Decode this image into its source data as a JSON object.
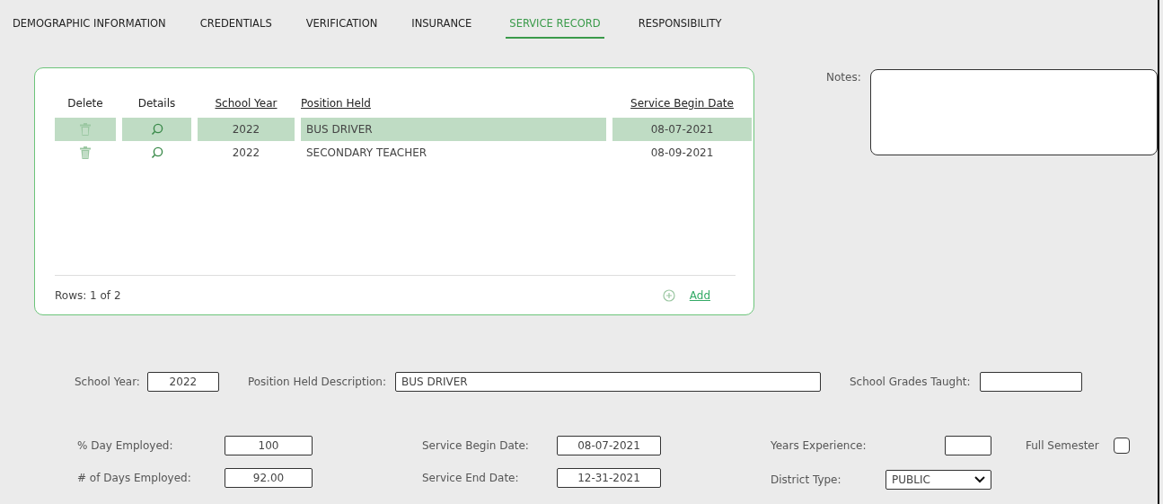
{
  "tabs": [
    {
      "label": "DEMOGRAPHIC INFORMATION",
      "selected": false
    },
    {
      "label": "CREDENTIALS",
      "selected": false
    },
    {
      "label": "VERIFICATION",
      "selected": false
    },
    {
      "label": "INSURANCE",
      "selected": false
    },
    {
      "label": "SERVICE RECORD",
      "selected": true
    },
    {
      "label": "RESPONSIBILITY",
      "selected": false
    }
  ],
  "table": {
    "columns": [
      {
        "label": "Delete",
        "sortable": false
      },
      {
        "label": "Details",
        "sortable": false
      },
      {
        "label": "School Year",
        "sortable": true
      },
      {
        "label": "Position Held",
        "sortable": true
      },
      {
        "label": "Service Begin Date",
        "sortable": true
      }
    ],
    "rows": [
      {
        "school_year": "2022",
        "position_held": "BUS DRIVER",
        "service_begin_date": "08-07-2021",
        "selected": true
      },
      {
        "school_year": "2022",
        "position_held": "SECONDARY TEACHER",
        "service_begin_date": "08-09-2021",
        "selected": false
      }
    ],
    "row_count": "Rows: 1 of 2",
    "add_link": "Add"
  },
  "notes": {
    "label": "Notes:"
  },
  "form": {
    "school_year": {
      "label": "School Year:",
      "value": "2022"
    },
    "position_held_description": {
      "label": "Position Held Description:",
      "value": "BUS DRIVER"
    },
    "school_grades_taught": {
      "label": "School Grades Taught:"
    },
    "percent_day_employed": {
      "label": "% Day Employed:",
      "value": "100"
    },
    "days_employed": {
      "label": "# of Days Employed:",
      "value": "92.00"
    },
    "service_begin_date": {
      "label": "Service Begin Date:",
      "value": "08-07-2021"
    },
    "service_end_date": {
      "label": "Service End Date:",
      "value": "12-31-2021"
    },
    "years_experience": {
      "label": "Years Experience:"
    },
    "district_type": {
      "label": "District Type:",
      "value": "PUBLIC"
    },
    "full_semester": {
      "label": "Full Semester",
      "checked": false
    }
  }
}
